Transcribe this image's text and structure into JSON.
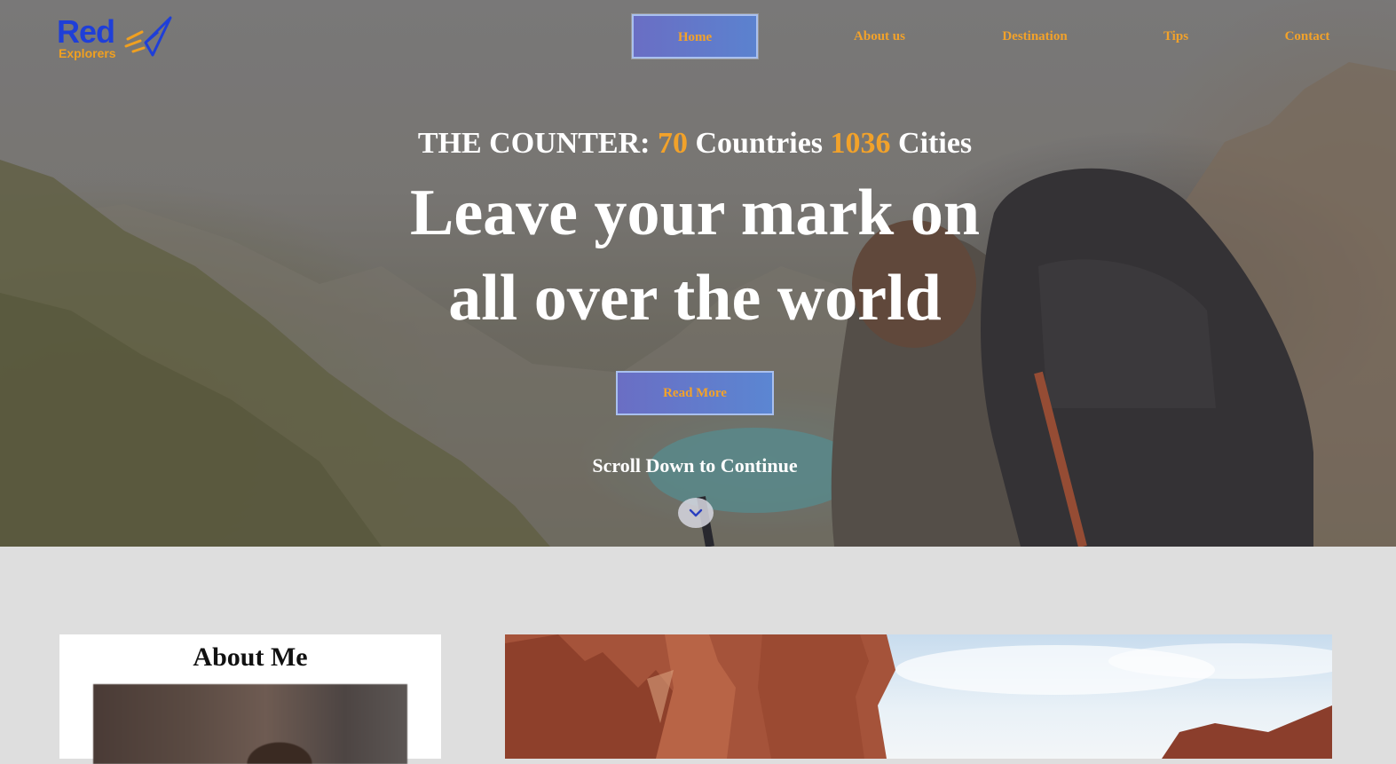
{
  "brand": {
    "name_main": "Red",
    "name_sub": "Explorers"
  },
  "nav": {
    "items": [
      {
        "label": "Home",
        "active": true
      },
      {
        "label": "About us",
        "active": false
      },
      {
        "label": "Destination",
        "active": false
      },
      {
        "label": "Tips",
        "active": false
      },
      {
        "label": "Contact",
        "active": false
      }
    ]
  },
  "hero": {
    "counter": {
      "prefix": "THE COUNTER:",
      "countries_value": "70",
      "countries_label": "Countries",
      "cities_value": "1036",
      "cities_label": "Cities"
    },
    "headline_line1": "Leave your mark on",
    "headline_line2": "all over the world",
    "cta_label": "Read More",
    "scroll_text": "Scroll Down to Continue",
    "scroll_icon": "chevron-down-icon"
  },
  "about": {
    "title": "About Me"
  },
  "colors": {
    "accent": "#f2a22a",
    "brand_blue": "#1f3fd8",
    "button_blue": "#5b82cf",
    "page_bg": "#dedede"
  }
}
